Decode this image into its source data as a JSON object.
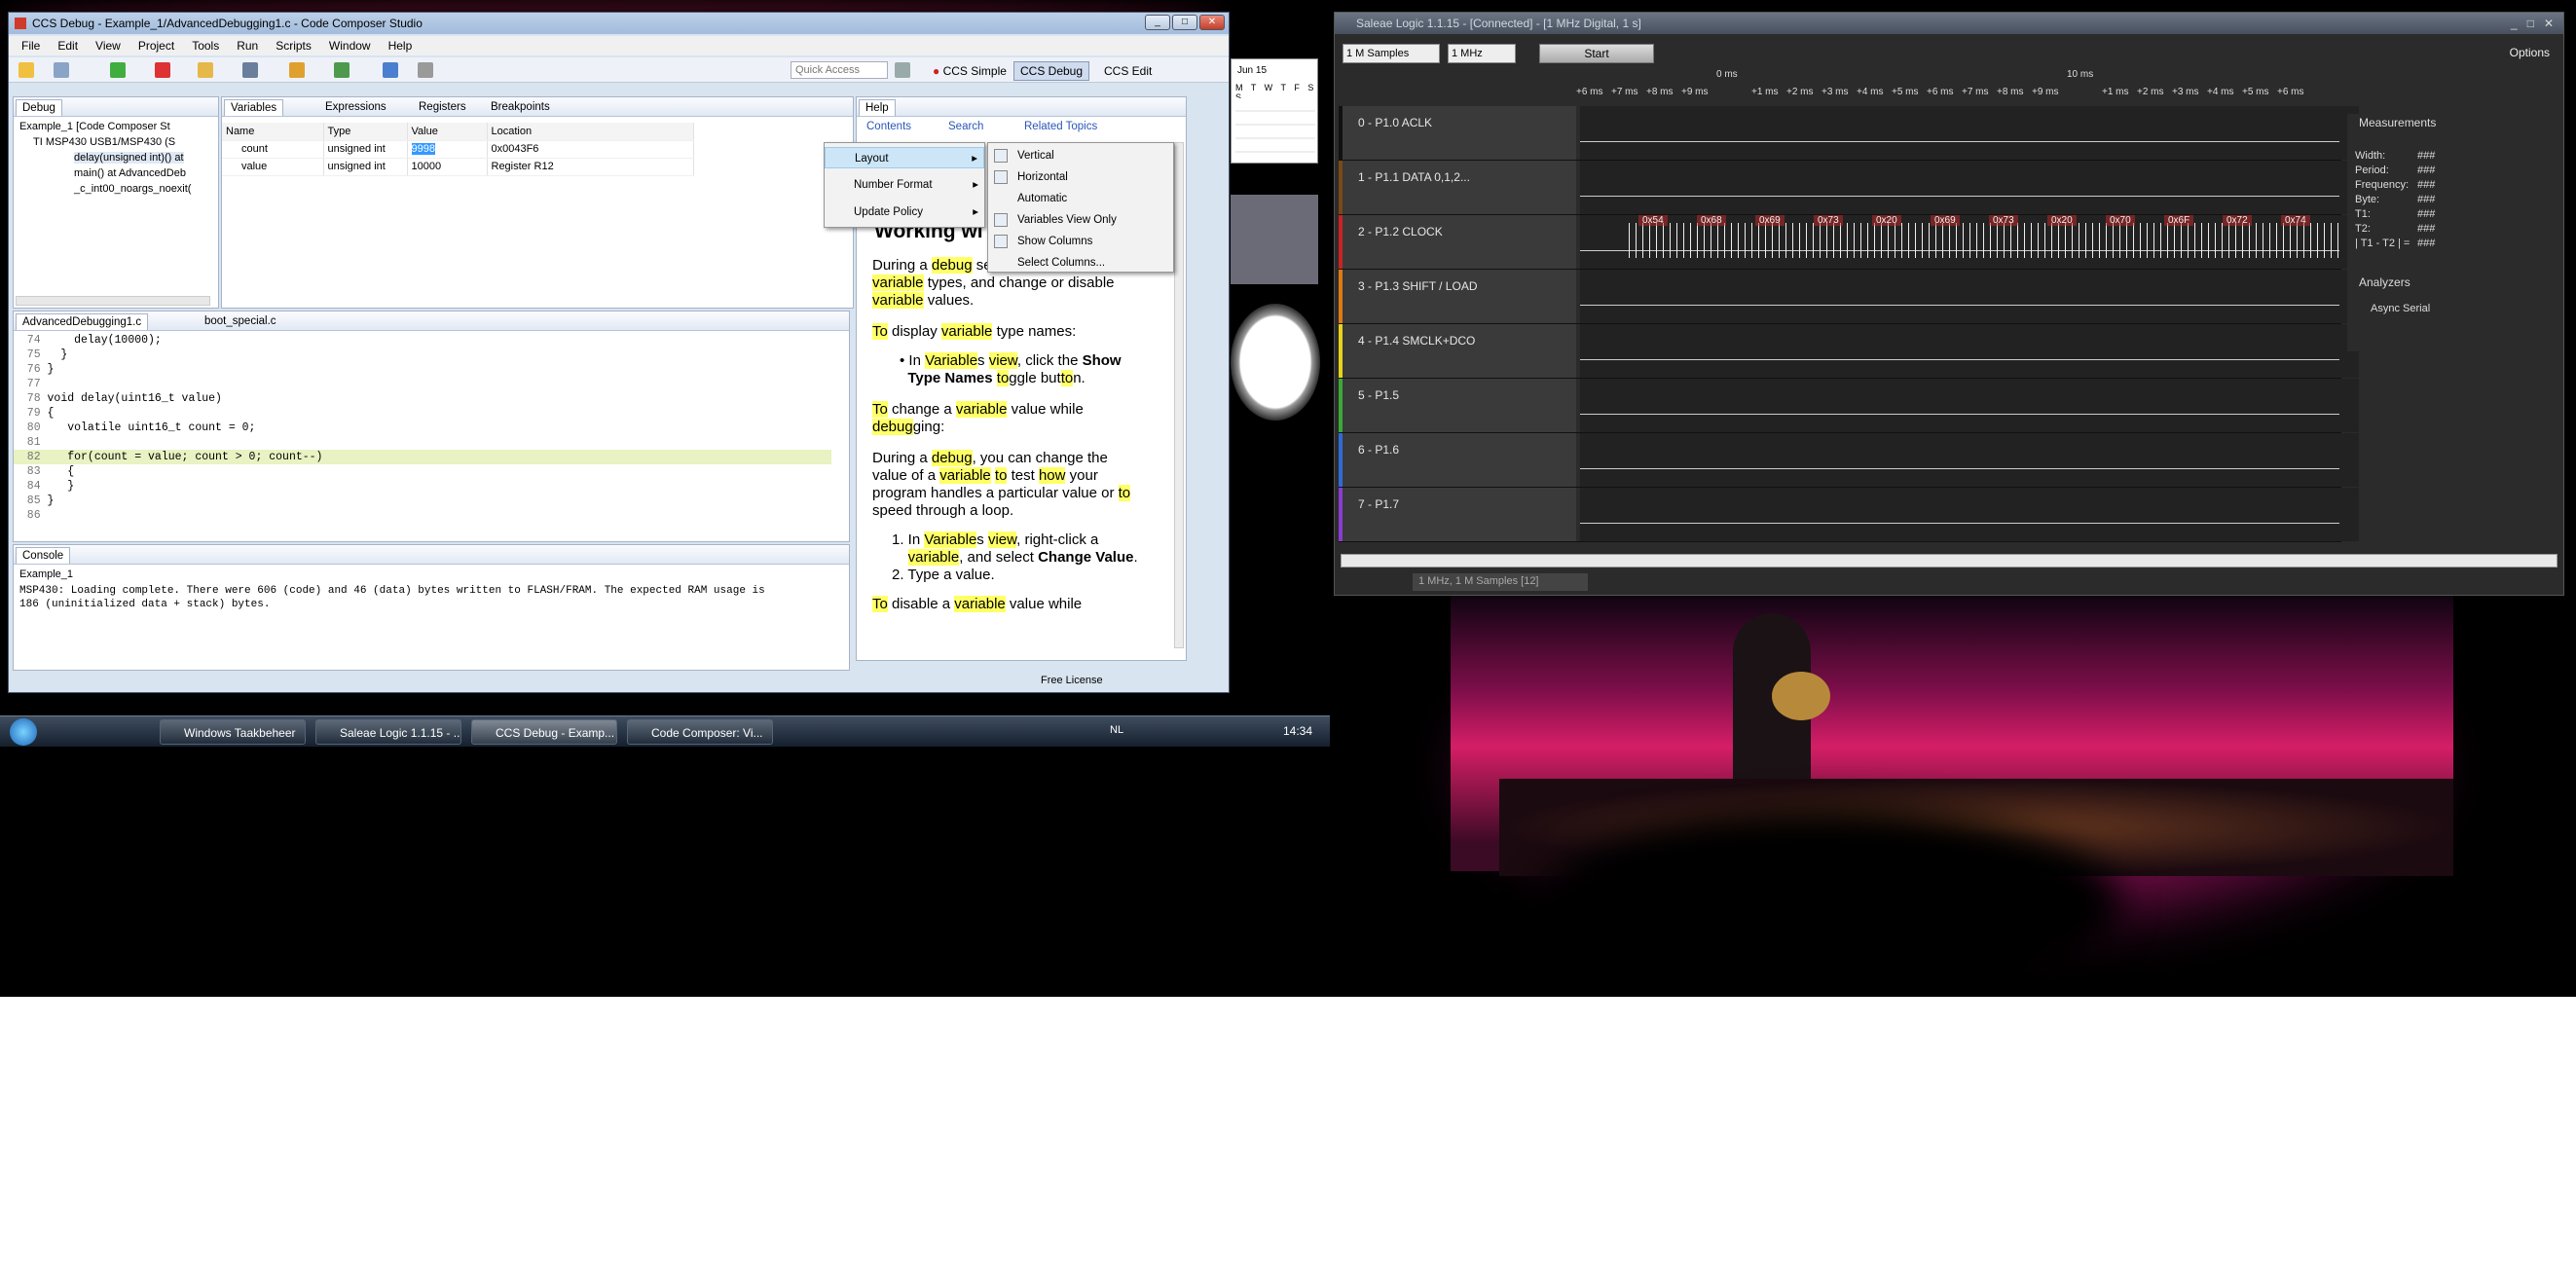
{
  "ccs": {
    "title": "CCS Debug - Example_1/AdvancedDebugging1.c - Code Composer Studio",
    "menu": [
      "File",
      "Edit",
      "View",
      "Project",
      "Tools",
      "Run",
      "Scripts",
      "Window",
      "Help"
    ],
    "quick_access": "Quick Access",
    "perspectives": [
      "CCS Simple",
      "CCS Debug",
      "CCS Edit"
    ],
    "debug_tab": "Debug",
    "debug_tree": [
      "Example_1 [Code Composer St",
      "TI MSP430 USB1/MSP430 (S",
      "delay(unsigned int)() at",
      "main() at AdvancedDeb",
      "_c_int00_noargs_noexit("
    ],
    "var_tabs": [
      "Variables",
      "Expressions",
      "Registers",
      "Breakpoints"
    ],
    "var_headers": [
      "Name",
      "Type",
      "Value",
      "Location"
    ],
    "var_rows": [
      {
        "name": "count",
        "type": "unsigned int",
        "value": "9998",
        "location": "0x0043F6"
      },
      {
        "name": "value",
        "type": "unsigned int",
        "value": "10000",
        "location": "Register R12"
      }
    ],
    "editor_tabs": [
      "AdvancedDebugging1.c",
      "boot_special.c"
    ],
    "code_lines": [
      {
        "n": "74",
        "t": "    delay(10000);"
      },
      {
        "n": "75",
        "t": "  }"
      },
      {
        "n": "76",
        "t": "}"
      },
      {
        "n": "77",
        "t": ""
      },
      {
        "n": "78",
        "t": "void delay(uint16_t value)"
      },
      {
        "n": "79",
        "t": "{"
      },
      {
        "n": "80",
        "t": "   volatile uint16_t count = 0;"
      },
      {
        "n": "81",
        "t": ""
      },
      {
        "n": "82",
        "t": "   for(count = value; count > 0; count--)"
      },
      {
        "n": "83",
        "t": "   {"
      },
      {
        "n": "84",
        "t": "   }"
      },
      {
        "n": "85",
        "t": "}"
      },
      {
        "n": "86",
        "t": ""
      }
    ],
    "console_tab": "Console",
    "console_name": "Example_1",
    "console_text": "MSP430: Loading complete. There were 606 (code) and 46 (data) bytes written to FLASH/FRAM. The expected RAM usage is\n186 (uninitialized data + stack) bytes.",
    "help_tab": "Help",
    "help_links": [
      "Contents",
      "Search",
      "Related Topics"
    ],
    "help_heading": "Working wi",
    "status_license": "Free License"
  },
  "context_menu": {
    "items": [
      "Layout",
      "Number Format",
      "Update Policy"
    ],
    "submenu": [
      "Vertical",
      "Horizontal",
      "Automatic",
      "Variables View Only",
      "Show Columns",
      "Select Columns..."
    ]
  },
  "gadget": {
    "month": "Jun 15",
    "days": "M T W T F S S"
  },
  "saleae": {
    "title": "Saleae Logic 1.1.15 - [Connected] - [1 MHz Digital, 1 s]",
    "samples": "1 M Samples",
    "rate": "1 MHz",
    "start": "Start",
    "options": "Options",
    "time_marks": [
      "+6 ms",
      "+7 ms",
      "+8 ms",
      "+9 ms",
      "0 ms",
      "+1 ms",
      "+2 ms",
      "+3 ms",
      "+4 ms",
      "+5 ms",
      "+6 ms",
      "+7 ms",
      "+8 ms",
      "+9 ms",
      "10 ms",
      "+1 ms",
      "+2 ms",
      "+3 ms",
      "+4 ms",
      "+5 ms",
      "+6 ms"
    ],
    "channels": [
      "0 - P1.0   ACLK",
      "1 - P1.1   DATA 0,1,2...",
      "2 - P1.2   CLOCK",
      "3 - P1.3   SHIFT / LOAD",
      "4 - P1.4   SMCLK+DCO",
      "5 - P1.5",
      "6 - P1.6",
      "7 - P1.7"
    ],
    "channel_colors": [
      "#111111",
      "#7a4a16",
      "#cc2222",
      "#e07a10",
      "#e8d21a",
      "#3aaa36",
      "#2f6bd8",
      "#8b3bd2"
    ],
    "bytes": [
      "0x54",
      "0x68",
      "0x69",
      "0x73",
      "0x20",
      "0x69",
      "0x73",
      "0x20",
      "0x70",
      "0x6F",
      "0x72",
      "0x74"
    ],
    "measurements_title": "Measurements",
    "measurements": [
      {
        "k": "Width:",
        "v": "###"
      },
      {
        "k": "Period:",
        "v": "###"
      },
      {
        "k": "Frequency:",
        "v": "###"
      },
      {
        "k": "Byte:",
        "v": "###"
      },
      {
        "k": "T1:",
        "v": "###"
      },
      {
        "k": "T2:",
        "v": "###"
      },
      {
        "k": "| T1 - T2 | =",
        "v": "###"
      }
    ],
    "analyzers_title": "Analyzers",
    "analyzer": "Async Serial",
    "bottom_field": "1 MHz, 1 M Samples [12]"
  },
  "taskbar": {
    "items": [
      "Windows Taakbeheer",
      "Saleae Logic 1.1.15 - ...",
      "CCS Debug - Examp...",
      "Code Composer: Vi..."
    ],
    "lang": "NL",
    "time": "14:34"
  }
}
